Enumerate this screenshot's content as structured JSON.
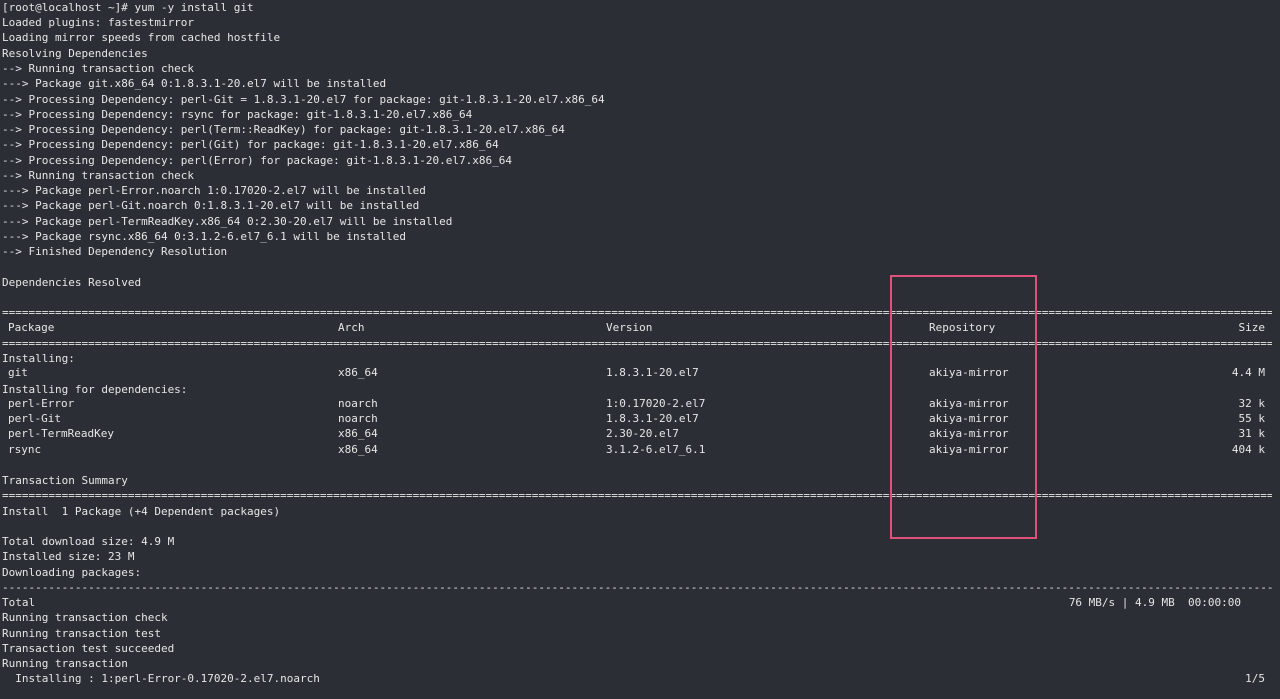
{
  "lines_top": [
    "[root@localhost ~]# yum -y install git",
    "Loaded plugins: fastestmirror",
    "Loading mirror speeds from cached hostfile",
    "Resolving Dependencies",
    "--> Running transaction check",
    "---> Package git.x86_64 0:1.8.3.1-20.el7 will be installed",
    "--> Processing Dependency: perl-Git = 1.8.3.1-20.el7 for package: git-1.8.3.1-20.el7.x86_64",
    "--> Processing Dependency: rsync for package: git-1.8.3.1-20.el7.x86_64",
    "--> Processing Dependency: perl(Term::ReadKey) for package: git-1.8.3.1-20.el7.x86_64",
    "--> Processing Dependency: perl(Git) for package: git-1.8.3.1-20.el7.x86_64",
    "--> Processing Dependency: perl(Error) for package: git-1.8.3.1-20.el7.x86_64",
    "--> Running transaction check",
    "---> Package perl-Error.noarch 1:0.17020-2.el7 will be installed",
    "---> Package perl-Git.noarch 0:1.8.3.1-20.el7 will be installed",
    "---> Package perl-TermReadKey.x86_64 0:2.30-20.el7 will be installed",
    "---> Package rsync.x86_64 0:3.1.2-6.el7_6.1 will be installed",
    "--> Finished Dependency Resolution",
    "",
    "Dependencies Resolved"
  ],
  "separator_eq": "================================================================================================================================================================================================================================================",
  "separator_dash": "--------------------------------------------------------------------------------------------------------------------------------------------------------------------------------------------------------------------------------------------------------",
  "table": {
    "headers": {
      "package": "Package",
      "arch": "Arch",
      "version": "Version",
      "repository": "Repository",
      "size": "Size"
    },
    "installing_label": "Installing:",
    "deps_label": "Installing for dependencies:",
    "rows": [
      {
        "package": "git",
        "arch": "x86_64",
        "version": "1.8.3.1-20.el7",
        "repository": "akiya-mirror",
        "size": "4.4 M"
      },
      {
        "package": "perl-Error",
        "arch": "noarch",
        "version": "1:0.17020-2.el7",
        "repository": "akiya-mirror",
        "size": "32 k"
      },
      {
        "package": "perl-Git",
        "arch": "noarch",
        "version": "1.8.3.1-20.el7",
        "repository": "akiya-mirror",
        "size": "55 k"
      },
      {
        "package": "perl-TermReadKey",
        "arch": "x86_64",
        "version": "2.30-20.el7",
        "repository": "akiya-mirror",
        "size": "31 k"
      },
      {
        "package": "rsync",
        "arch": "x86_64",
        "version": "3.1.2-6.el7_6.1",
        "repository": "akiya-mirror",
        "size": "404 k"
      }
    ]
  },
  "summary": {
    "title": "Transaction Summary",
    "install_line": "Install  1 Package (+4 Dependent packages)",
    "download_size": "Total download size: 4.9 M",
    "installed_size": "Installed size: 23 M",
    "downloading": "Downloading packages:"
  },
  "total": {
    "label": "Total",
    "stats": "76 MB/s | 4.9 MB  00:00:00"
  },
  "lines_bottom": [
    "Running transaction check",
    "Running transaction test",
    "Transaction test succeeded",
    "Running transaction"
  ],
  "progress": {
    "line": "  Installing : 1:perl-Error-0.17020-2.el7.noarch",
    "count": "1/5"
  },
  "colors": {
    "background": "#2b2e35",
    "text": "#e6e6e6",
    "highlight": "#e0517a"
  }
}
